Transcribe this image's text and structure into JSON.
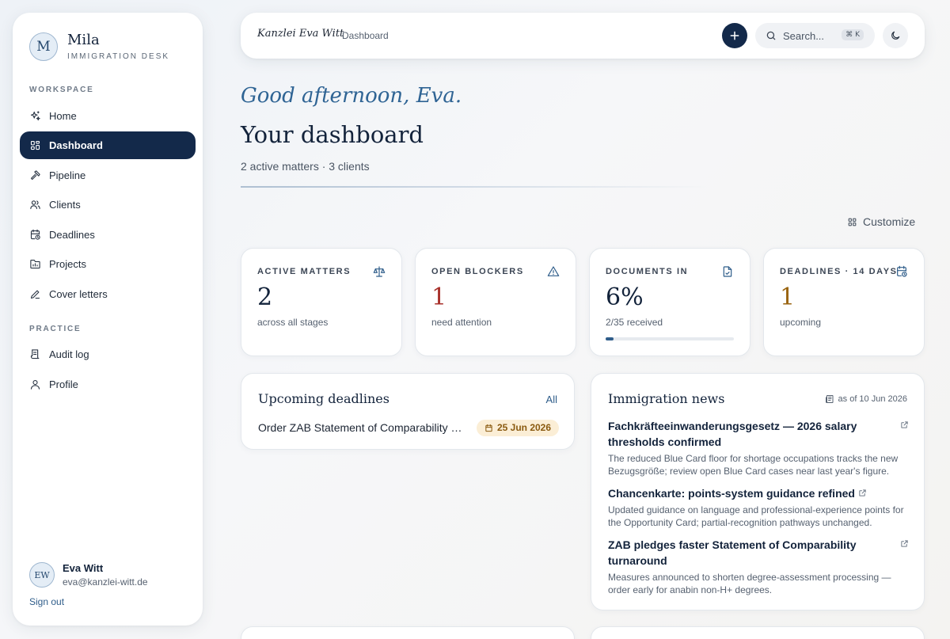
{
  "sidebar": {
    "brand_mark": "M",
    "brand_name": "Mila",
    "brand_sub": "IMMIGRATION DESK",
    "workspace_label": "WORKSPACE",
    "practice_label": "PRACTICE",
    "items": [
      {
        "label": "Home",
        "icon": "sparkles-icon"
      },
      {
        "label": "Dashboard",
        "icon": "grid-icon",
        "active": true
      },
      {
        "label": "Pipeline",
        "icon": "hammer-icon"
      },
      {
        "label": "Clients",
        "icon": "users-icon"
      },
      {
        "label": "Deadlines",
        "icon": "calendar-clock-icon"
      },
      {
        "label": "Projects",
        "icon": "folder-chart-icon"
      },
      {
        "label": "Cover letters",
        "icon": "pen-icon"
      }
    ],
    "practice_items": [
      {
        "label": "Audit log",
        "icon": "log-icon"
      },
      {
        "label": "Profile",
        "icon": "user-icon"
      }
    ],
    "user": {
      "initials": "EW",
      "name": "Eva Witt",
      "email": "eva@kanzlei-witt.de"
    },
    "signout": "Sign out"
  },
  "topbar": {
    "firm": "Kanzlei Eva Witt",
    "breadcrumb": "Dashboard",
    "search_placeholder": "Search...",
    "shortcut": "⌘ K"
  },
  "header": {
    "greeting": "Good afternoon, Eva.",
    "title": "Your dashboard",
    "subtitle": "2 active matters · 3 clients",
    "customize": "Customize"
  },
  "stats": [
    {
      "label": "ACTIVE MATTERS",
      "value": "2",
      "note": "across all stages",
      "icon": "scales-icon",
      "color": "#13233b"
    },
    {
      "label": "OPEN BLOCKERS",
      "value": "1",
      "note": "need attention",
      "icon": "warning-icon",
      "color": "#a8322c"
    },
    {
      "label": "DOCUMENTS IN",
      "value": "6%",
      "note": "2/35 received",
      "icon": "document-icon",
      "color": "#13233b",
      "progress": 0.06
    },
    {
      "label": "DEADLINES · 14 DAYS",
      "value": "1",
      "note": "upcoming",
      "icon": "calendar-clock-icon",
      "color": "#9a6410"
    }
  ],
  "deadlines": {
    "title": "Upcoming deadlines",
    "link": "All",
    "items": [
      {
        "text": "Order ZAB Statement of Comparability (ZAB)",
        "date": "25 Jun 2026"
      }
    ]
  },
  "news": {
    "title": "Immigration news",
    "as_of": "as of 10 Jun 2026",
    "items": [
      {
        "title": "Fachkräfteeinwanderungsgesetz — 2026 salary thresholds confirmed",
        "body": "The reduced Blue Card floor for shortage occupations tracks the new Bezugsgröße; review open Blue Card cases near last year's figure."
      },
      {
        "title": "Chancenkarte: points-system guidance refined",
        "body": "Updated guidance on language and professional-experience points for the Opportunity Card; partial-recognition pathways unchanged."
      },
      {
        "title": "ZAB pledges faster Statement of Comparability turnaround",
        "body": "Measures announced to shorten degree-assessment processing — order early for anabin non-H+ degrees."
      }
    ]
  },
  "colors": {
    "accent": "#13294a",
    "link": "#2f5d8a",
    "warning_badge": "#fbeed6"
  }
}
